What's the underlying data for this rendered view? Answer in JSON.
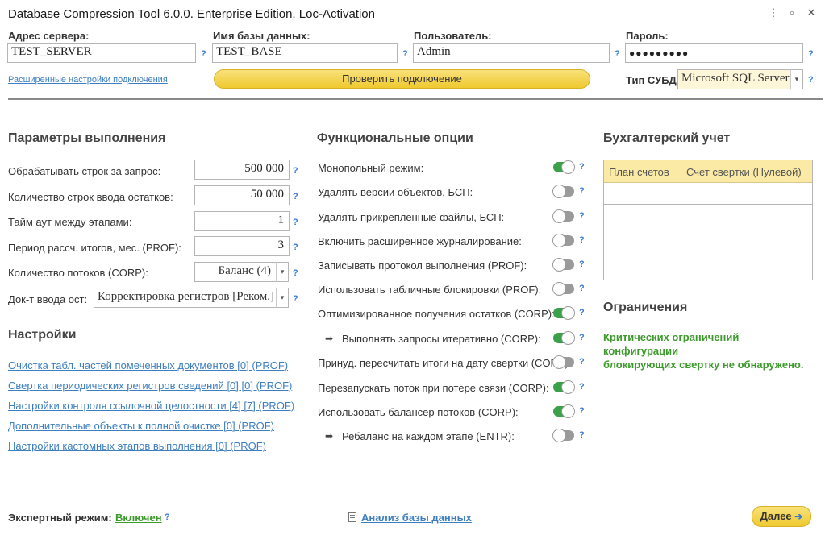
{
  "window": {
    "title": "Database Compression Tool 6.0.0. Enterprise Edition. Loc-Activation",
    "controls": [
      "⋮",
      "▫",
      "✕"
    ]
  },
  "connection": {
    "server_label": "Адрес сервера:",
    "server_value": "TEST_SERVER",
    "db_label": "Имя базы данных:",
    "db_value": "TEST_BASE",
    "user_label": "Пользователь:",
    "user_value": "Admin",
    "password_label": "Пароль:",
    "password_value": "●●●●●●●●●",
    "advanced_link": "Расширенные настройки подключения",
    "check_button": "Проверить подключение",
    "dbms_label": "Тип СУБД:",
    "dbms_value": "Microsoft SQL Server",
    "help": "?"
  },
  "exec_params": {
    "title": "Параметры выполнения",
    "rows": [
      {
        "label": "Обрабатывать строк за запрос:",
        "value": "500 000"
      },
      {
        "label": "Количество строк ввода остатков:",
        "value": "50 000"
      },
      {
        "label": "Тайм аут между этапами:",
        "value": "1"
      },
      {
        "label": "Период рассч. итогов, мес. (PROF):",
        "value": "3"
      }
    ],
    "threads_label": "Количество потоков (CORP):",
    "threads_value": "Баланс (4)",
    "doc_label": "Док-т ввода ост:",
    "doc_value": "Корректировка регистров [Реком.]"
  },
  "settings": {
    "title": "Настройки",
    "links": [
      "Очистка табл. частей помеченных документов [0] (PROF)",
      "Свертка периодических регистров сведений [0] [0] (PROF)",
      "Настройки контроля ссылочной целостности [4] [7] (PROF)",
      "Дополнительные объекты к полной очистке [0] (PROF)",
      "Настройки кастомных этапов выполнения [0] (PROF)"
    ]
  },
  "options": {
    "title": "Функциональные опции",
    "items": [
      {
        "label": "Монопольный режим:",
        "on": true,
        "sub": false
      },
      {
        "label": "Удалять версии объектов, БСП:",
        "on": false,
        "sub": false
      },
      {
        "label": "Удалять прикрепленные файлы, БСП:",
        "on": false,
        "sub": false
      },
      {
        "label": "Включить расширенное журналирование:",
        "on": false,
        "sub": false
      },
      {
        "label": "Записывать протокол выполнения (PROF):",
        "on": false,
        "sub": false
      },
      {
        "label": "Использовать табличные блокировки (PROF):",
        "on": false,
        "sub": false
      },
      {
        "label": "Оптимизированное получения остатков (CORP):",
        "on": true,
        "sub": false
      },
      {
        "label": "Выполнять запросы итеративно (CORP):",
        "on": true,
        "sub": true
      },
      {
        "label": "Принуд. пересчитать итоги на дату свертки (CORP):",
        "on": false,
        "sub": false
      },
      {
        "label": "Перезапускать поток при потере связи (CORP):",
        "on": true,
        "sub": false
      },
      {
        "label": "Использовать балансер потоков (CORP):",
        "on": true,
        "sub": false
      },
      {
        "label": "Ребаланс на каждом этапе (ENTR):",
        "on": false,
        "sub": true
      }
    ],
    "sub_arrow": "➡"
  },
  "accounting": {
    "title": "Бухгалтерский учет",
    "col1": "План счетов",
    "col2": "Счет свертки (Нулевой)"
  },
  "limits": {
    "title": "Ограничения",
    "text_line1": "Критических ограничений конфигурации",
    "text_line2": "блокирующих свертку не обнаружено."
  },
  "footer": {
    "expert_label": "Экспертный режим:",
    "expert_value": "Включен",
    "analysis_link": "Анализ базы данных",
    "next_button": "Далее",
    "next_icon": "➔"
  },
  "colors": {
    "accent_yellow": "#efc92f",
    "toggle_on": "#3aa04a",
    "toggle_off": "#9a9a9a",
    "link": "#3d7fbf",
    "ok_text": "#3d9a2c"
  }
}
